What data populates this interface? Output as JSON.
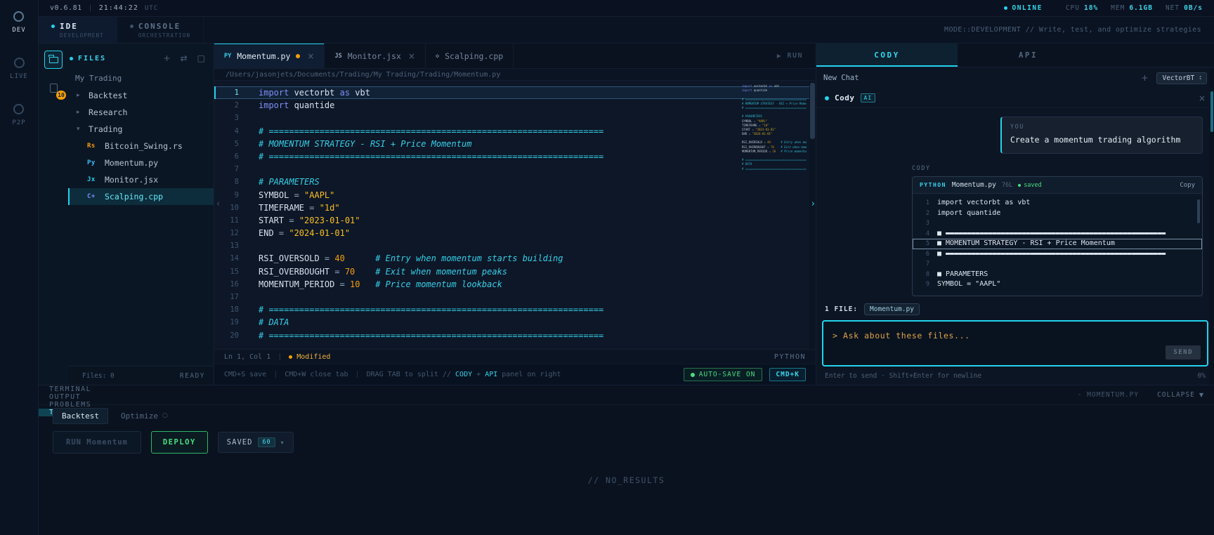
{
  "icons": {
    "close": "×",
    "plus": "+",
    "split": "⇄",
    "window": "□",
    "play": "▶",
    "caret_down": "▾",
    "caret_up": "▴",
    "arrow_down": "▼",
    "chevron_left": "‹",
    "chevron_right": "›"
  },
  "colors": {
    "accent": "#22d3ee",
    "amber": "#f59e0b",
    "green": "#4ade80"
  },
  "topbar": {
    "version": "v0.6.81",
    "divider": "|",
    "time": "21:44:22",
    "timezone": "UTC",
    "online_label": "ONLINE",
    "stats": [
      {
        "label": "CPU",
        "value": "18%"
      },
      {
        "label": "MEM",
        "value": "6.1GB"
      },
      {
        "label": "NET",
        "value": "0B/s"
      }
    ]
  },
  "modebar": {
    "tabs": [
      {
        "title": "IDE",
        "subtitle": "DEVELOPMENT",
        "active": true
      },
      {
        "title": "CONSOLE",
        "subtitle": "ORCHESTRATION",
        "active": false
      }
    ],
    "mode_text": "MODE::DEVELOPMENT // Write, test, and optimize strategies"
  },
  "activity_rail": {
    "items": [
      {
        "label": "DEV",
        "active": true
      },
      {
        "label": "LIVE",
        "active": false
      },
      {
        "label": "P2P",
        "active": false
      }
    ]
  },
  "files": {
    "title": "FILES",
    "rail_badge": "10",
    "root": "My Trading",
    "tree": [
      {
        "type": "folder",
        "caret": "▸",
        "name": "Backtest"
      },
      {
        "type": "folder",
        "caret": "▸",
        "name": "Research"
      },
      {
        "type": "folder",
        "caret": "▾",
        "name": "Trading"
      },
      {
        "type": "file",
        "icon": "Rs",
        "icon_color": "#f59e0b",
        "name": "Bitcoin_Swing.rs"
      },
      {
        "type": "file",
        "icon": "Py",
        "icon_color": "#38bdf8",
        "name": "Momentum.py"
      },
      {
        "type": "file",
        "icon": "Jx",
        "icon_color": "#22d3ee",
        "name": "Monitor.jsx"
      },
      {
        "type": "file",
        "icon": "C+",
        "icon_color": "#818cf8",
        "name": "Scalping.cpp",
        "selected": true
      }
    ],
    "footer_left": "Files: 0",
    "footer_right": "READY"
  },
  "editor": {
    "tabs": [
      {
        "icon": "PY",
        "icon_color": "#38cdeb",
        "label": "Momentum.py",
        "modified": true,
        "active": true,
        "closable": true
      },
      {
        "icon": "JS",
        "icon_color": "#8fa3b8",
        "label": "Monitor.jsx",
        "modified": false,
        "active": false,
        "closable": true
      },
      {
        "icon": "◇",
        "icon_color": "#8fa3b8",
        "label": "Scalping.cpp",
        "modified": false,
        "active": false,
        "closable": false
      }
    ],
    "run_label": "RUN",
    "breadcrumb": "/Users/jasonjets/Documents/Trading/My Trading/Trading/Momentum.py",
    "active_line": 1,
    "lines": [
      {
        "n": 1,
        "segs": [
          [
            "kw",
            "import"
          ],
          [
            "pl",
            " vectorbt "
          ],
          [
            "kw",
            "as"
          ],
          [
            "pl",
            " vbt"
          ]
        ]
      },
      {
        "n": 2,
        "segs": [
          [
            "kw",
            "import"
          ],
          [
            "pl",
            " quantide"
          ]
        ]
      },
      {
        "n": 3,
        "segs": []
      },
      {
        "n": 4,
        "segs": [
          [
            "cm",
            "# =================================================================="
          ]
        ]
      },
      {
        "n": 5,
        "segs": [
          [
            "cm",
            "# MOMENTUM STRATEGY - RSI + Price Momentum"
          ]
        ]
      },
      {
        "n": 6,
        "segs": [
          [
            "cm",
            "# =================================================================="
          ]
        ]
      },
      {
        "n": 7,
        "segs": []
      },
      {
        "n": 8,
        "segs": [
          [
            "cm",
            "# PARAMETERS"
          ]
        ]
      },
      {
        "n": 9,
        "segs": [
          [
            "pl",
            "SYMBOL "
          ],
          [
            "op",
            "= "
          ],
          [
            "st",
            "\"AAPL\""
          ]
        ]
      },
      {
        "n": 10,
        "segs": [
          [
            "pl",
            "TIMEFRAME "
          ],
          [
            "op",
            "= "
          ],
          [
            "st",
            "\"1d\""
          ]
        ]
      },
      {
        "n": 11,
        "segs": [
          [
            "pl",
            "START "
          ],
          [
            "op",
            "= "
          ],
          [
            "st",
            "\"2023-01-01\""
          ]
        ]
      },
      {
        "n": 12,
        "segs": [
          [
            "pl",
            "END "
          ],
          [
            "op",
            "= "
          ],
          [
            "st",
            "\"2024-01-01\""
          ]
        ]
      },
      {
        "n": 13,
        "segs": []
      },
      {
        "n": 14,
        "segs": [
          [
            "pl",
            "RSI_OVERSOLD "
          ],
          [
            "op",
            "= "
          ],
          [
            "nu",
            "40"
          ],
          [
            "pl",
            "      "
          ],
          [
            "cm",
            "# Entry when momentum starts building"
          ]
        ]
      },
      {
        "n": 15,
        "segs": [
          [
            "pl",
            "RSI_OVERBOUGHT "
          ],
          [
            "op",
            "= "
          ],
          [
            "nu",
            "70"
          ],
          [
            "pl",
            "    "
          ],
          [
            "cm",
            "# Exit when momentum peaks"
          ]
        ]
      },
      {
        "n": 16,
        "segs": [
          [
            "pl",
            "MOMENTUM_PERIOD "
          ],
          [
            "op",
            "= "
          ],
          [
            "nu",
            "10"
          ],
          [
            "pl",
            "   "
          ],
          [
            "cm",
            "# Price momentum lookback"
          ]
        ]
      },
      {
        "n": 17,
        "segs": []
      },
      {
        "n": 18,
        "segs": [
          [
            "cm",
            "# =================================================================="
          ]
        ]
      },
      {
        "n": 19,
        "segs": [
          [
            "cm",
            "# DATA"
          ]
        ]
      },
      {
        "n": 20,
        "segs": [
          [
            "cm",
            "# =================================================================="
          ]
        ]
      }
    ],
    "statusbar": {
      "position": "Ln 1, Col 1",
      "divider": "|",
      "modified": "Modified",
      "language": "PYTHON"
    },
    "hints": {
      "save": "CMD+S save",
      "divider": "|",
      "close": "CMD+W close tab",
      "drag_pre": "DRAG TAB to split // ",
      "drag_cody": "CODY",
      "drag_mid": " + ",
      "drag_api": "API",
      "drag_post": " panel on right",
      "autosave": "AUTO-SAVE ON",
      "cmdk": "CMD+K"
    }
  },
  "cody": {
    "tab_cody": "CODY",
    "tab_api": "API",
    "new_chat": "New Chat",
    "model": "VectorBT",
    "header_name": "Cody",
    "header_badge": "AI",
    "user_label": "YOU",
    "user_message": "Create a momentum trading algorithm",
    "assistant_label": "CODY",
    "card": {
      "lang": "PYTHON",
      "filename": "Momentum.py",
      "lines_count": "76L",
      "saved": "saved",
      "copy": "Copy",
      "lines": [
        {
          "n": 1,
          "text": "import vectorbt as vbt"
        },
        {
          "n": 2,
          "text": "import quantide"
        },
        {
          "n": 3,
          "text": ""
        },
        {
          "n": 4,
          "text": "■ ▬▬▬▬▬▬▬▬▬▬▬▬▬▬▬▬▬▬▬▬▬▬▬▬▬▬▬▬▬▬▬▬▬▬▬▬▬▬▬▬▬▬▬▬▬▬▬▬▬▬▬▬"
        },
        {
          "n": 5,
          "text": "■ MOMENTUM STRATEGY - RSI + Price Momentum",
          "selected": true
        },
        {
          "n": 6,
          "text": "■ ▬▬▬▬▬▬▬▬▬▬▬▬▬▬▬▬▬▬▬▬▬▬▬▬▬▬▬▬▬▬▬▬▬▬▬▬▬▬▬▬▬▬▬▬▬▬▬▬▬▬▬▬"
        },
        {
          "n": 7,
          "text": ""
        },
        {
          "n": 8,
          "text": "■ PARAMETERS"
        },
        {
          "n": 9,
          "text": "SYMBOL = \"AAPL\""
        }
      ]
    },
    "files_label": "1 FILE:",
    "file_chip": "Momentum.py",
    "input_placeholder": "> Ask about these files...",
    "send_label": "SEND",
    "footer_hint": "Enter to send · Shift+Enter for newline",
    "footer_pct": "0%"
  },
  "bottom": {
    "tabs": [
      {
        "label": "TERMINAL",
        "active": false
      },
      {
        "label": "OUTPUT",
        "active": false
      },
      {
        "label": "PROBLEMS",
        "active": false
      },
      {
        "label": "TRADING",
        "active": true
      }
    ],
    "right_file": "- MOMENTUM.PY",
    "collapse": "COLLAPSE",
    "subtabs": [
      {
        "label": "Backtest",
        "active": true
      },
      {
        "label": "Optimize",
        "active": false,
        "icon": "○"
      }
    ],
    "run_button": "RUN Momentum",
    "deploy_button": "DEPLOY",
    "saved_label": "SAVED",
    "saved_badge": "60",
    "no_results": "// NO_RESULTS"
  }
}
